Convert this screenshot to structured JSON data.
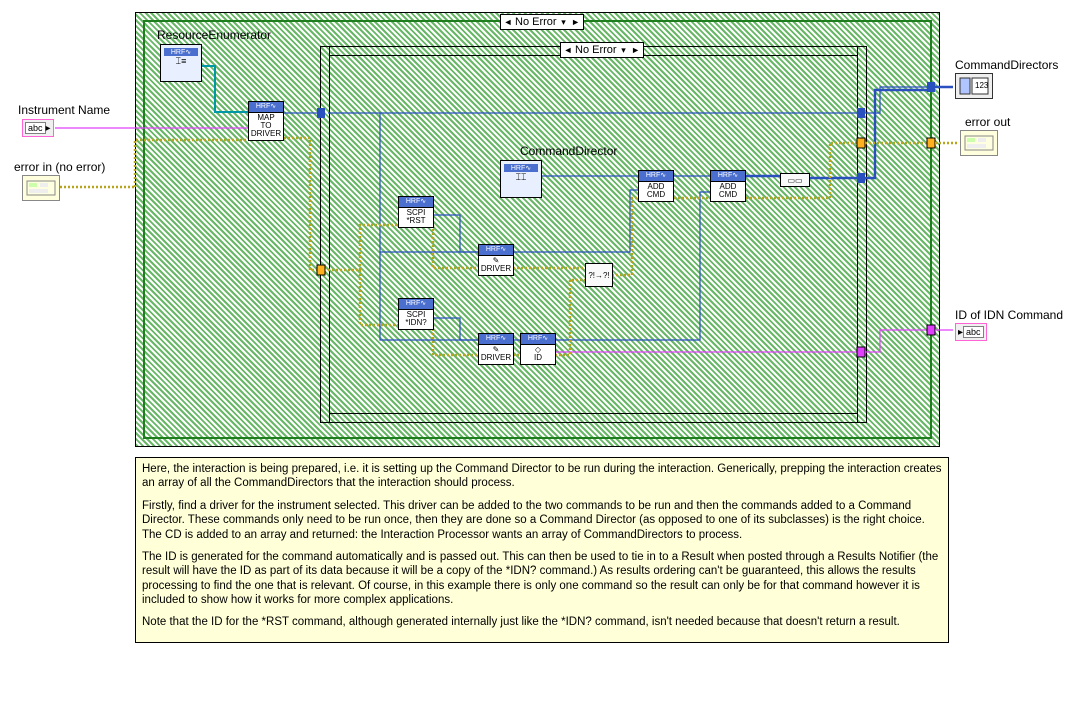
{
  "labels": {
    "resourceEnumerator": "ResourceEnumerator",
    "instrumentName": "Instrument Name",
    "errorIn": "error in (no error)",
    "commandDirector": "CommandDirector",
    "commandDirectors": "CommandDirectors",
    "errorOut": "error out",
    "idOfIdn": "ID of IDN Command"
  },
  "selector": {
    "outer": "No Error",
    "inner": "No Error",
    "leftArrow": "◄",
    "rightArrow": "►",
    "downArrow": "▾"
  },
  "nodes": {
    "banner": "HRF∿",
    "mapToDriver1": "MAP",
    "mapToDriver2": "TO",
    "mapToDriver3": "DRIVER",
    "scpi": "SCPI",
    "rst": "*RST",
    "idn": "*IDN?",
    "driver": "DRIVER",
    "id": "ID",
    "addCmd1": "ADD",
    "addCmd2": "CMD",
    "cdGlyph": "⌶⌶",
    "buildArray": "▭▭",
    "bundle": "?!→?!"
  },
  "terminals": {
    "abc": "abc",
    "arrayIdx": "123"
  },
  "note": {
    "p1": "Here, the interaction is being prepared, i.e. it is setting up the Command Director to be run during the interaction.  Generically, prepping the interaction creates an array of all the CommandDirectors that the interaction should process.",
    "p2": "Firstly, find a driver for the instrument selected.  This driver can be added to the two commands to be run and then the commands added to a Command Director.  These commands only need to be run once, then they are done so a Command Director (as opposed to one of its subclasses) is the right choice.  The CD is added to an array and returned: the Interaction Processor wants an array of CommandDirectors to process.",
    "p3": "The ID is generated for the command automatically and is passed out.  This can then be used to tie in to a Result when posted through a Results Notifier (the result will have the ID as part of its data because it will be a copy of the *IDN? command.)  As results ordering can't be guaranteed, this allows the results processing to find the one that is relevant.  Of course, in this example there is only one command so the result can only be for that command however it is included to show how it works for more complex applications.",
    "p4": "Note that the ID for the *RST command, although generated internally just like the *IDN? command, isn't needed because that doesn't return a result."
  }
}
